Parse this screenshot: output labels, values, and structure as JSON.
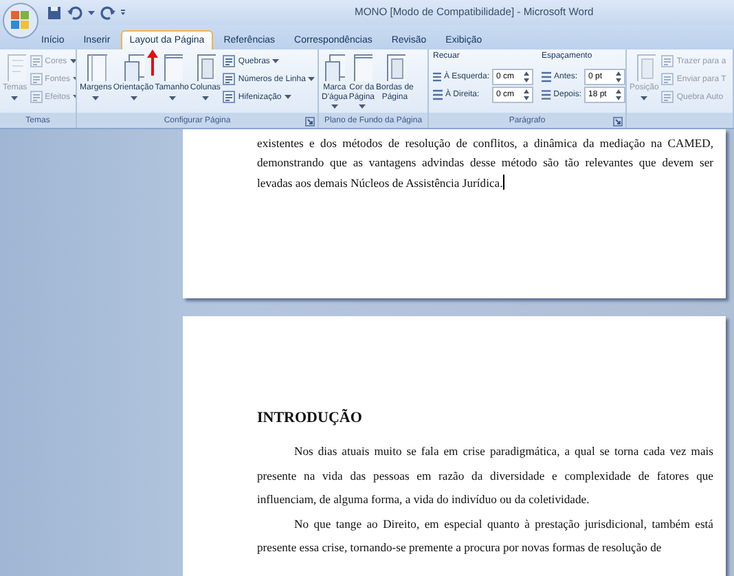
{
  "window": {
    "title": "MONO [Modo de Compatibilidade] - Microsoft Word"
  },
  "tabs": [
    {
      "label": "Início",
      "selected": false
    },
    {
      "label": "Inserir",
      "selected": false
    },
    {
      "label": "Layout da Página",
      "selected": true
    },
    {
      "label": "Referências",
      "selected": false
    },
    {
      "label": "Correspondências",
      "selected": false
    },
    {
      "label": "Revisão",
      "selected": false
    },
    {
      "label": "Exibição",
      "selected": false
    }
  ],
  "ribbon": [
    {
      "kind": "buttons",
      "label": "Temas",
      "launcher": false,
      "buttons": [
        {
          "label": "Temas",
          "dropdown": true,
          "disabled": true
        }
      ],
      "small_buttons": [
        {
          "label": "Cores",
          "dropdown": true,
          "disabled": true
        },
        {
          "label": "Fontes",
          "dropdown": true,
          "disabled": true
        },
        {
          "label": "Efeitos",
          "dropdown": true,
          "disabled": true
        }
      ]
    },
    {
      "kind": "buttons",
      "label": "Configurar Página",
      "launcher": true,
      "buttons": [
        {
          "label": "Margens",
          "dropdown": true,
          "disabled": false
        },
        {
          "label": "Orientação",
          "dropdown": true,
          "disabled": false
        },
        {
          "label": "Tamanho",
          "dropdown": true,
          "disabled": false
        },
        {
          "label": "Colunas",
          "dropdown": true,
          "disabled": false
        }
      ],
      "small_buttons": [
        {
          "label": "Quebras",
          "dropdown": true,
          "disabled": false
        },
        {
          "label": "Números de Linha",
          "dropdown": true,
          "disabled": false
        },
        {
          "label": "Hifenização",
          "dropdown": true,
          "disabled": false
        }
      ]
    },
    {
      "kind": "buttons",
      "label": "Plano de Fundo da Página",
      "launcher": false,
      "buttons": [
        {
          "label": "Marca D'água",
          "dropdown": true,
          "disabled": false
        },
        {
          "label": "Cor da Página",
          "dropdown": true,
          "disabled": false
        },
        {
          "label": "Bordas de Página",
          "dropdown": false,
          "disabled": false
        }
      ]
    },
    {
      "kind": "fields",
      "label": "Parágrafo",
      "launcher": true,
      "columns": [
        {
          "heading": "Recuar",
          "fields": [
            {
              "label": "À Esquerda:",
              "value": "0 cm"
            },
            {
              "label": "À Direita:",
              "value": "0 cm"
            }
          ]
        },
        {
          "heading": "Espaçamento",
          "fields": [
            {
              "label": "Antes:",
              "value": "0 pt"
            },
            {
              "label": "Depois:",
              "value": "18 pt"
            }
          ]
        }
      ]
    },
    {
      "kind": "buttons",
      "launcher": false,
      "buttons": [
        {
          "label": "Posição",
          "dropdown": true,
          "disabled": true
        }
      ],
      "small_buttons": [
        {
          "label": "Trazer para a",
          "dropdown": false,
          "disabled": true
        },
        {
          "label": "Enviar para T",
          "dropdown": false,
          "disabled": true
        },
        {
          "label": "Quebra Auto",
          "dropdown": false,
          "disabled": true
        }
      ]
    }
  ],
  "pages": [
    {
      "blocks": [
        {
          "kind": "paragraph",
          "text": "existentes e dos métodos de resolução de conflitos, a dinâmica da mediação na CAMED, demonstrando que as vantagens advindas desse método são tão relevantes que devem ser levadas aos demais Núcleos de Assistência Jurídica.",
          "cursor": true
        }
      ]
    },
    {
      "blocks": [
        {
          "kind": "heading",
          "text": "INTRODUÇÃO"
        },
        {
          "kind": "paragraph",
          "text": "Nos dias atuais muito se fala em crise paradigmática, a qual se torna cada vez mais presente na vida das pessoas em razão da diversidade e complexidade de fatores que influenciam, de alguma forma, a vida do indivíduo ou da coletividade.",
          "cursor": false
        },
        {
          "kind": "paragraph",
          "text": "No que tange ao Direito, em especial quanto à prestação jurisdicional, também está presente essa crise, tornando-se premente a procura por novas formas de resolução de",
          "cursor": false
        }
      ]
    }
  ]
}
